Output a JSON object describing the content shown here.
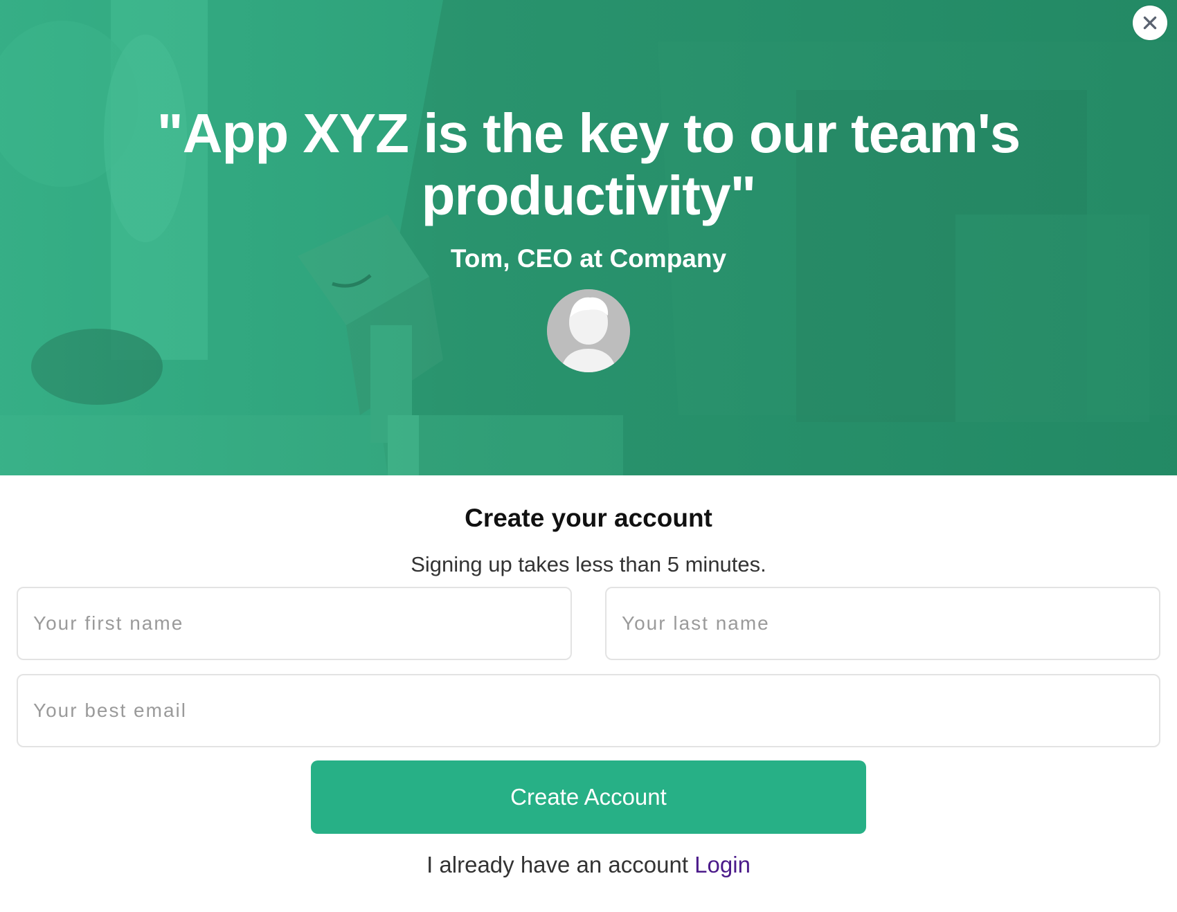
{
  "hero": {
    "quote": "\"App XYZ is the key to our team's productivity\"",
    "author": "Tom, CEO at Company",
    "avatar_icon": "user-silhouette-icon",
    "background_color": "#2f9e79"
  },
  "close": {
    "icon": "close-icon",
    "glyph": "✕"
  },
  "form": {
    "title": "Create your account",
    "subtitle": "Signing up takes less than 5 minutes.",
    "first_name_placeholder": "Your first name",
    "last_name_placeholder": "Your last name",
    "email_placeholder": "Your best email",
    "submit_label": "Create Account",
    "login_prompt": "I already have an account",
    "login_link": "Login",
    "accent_color": "#27b086",
    "link_color": "#4b1a8a"
  }
}
